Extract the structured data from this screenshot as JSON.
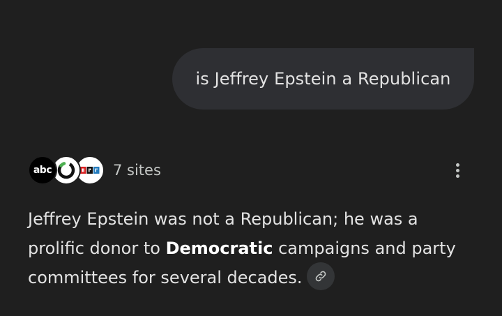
{
  "user_query": "is Jeffrey Epstein a Republican",
  "sources": {
    "logos": [
      {
        "name": "abc",
        "text": "abc"
      },
      {
        "name": "ring-logo"
      },
      {
        "name": "npr"
      }
    ],
    "count_label": "7 sites"
  },
  "answer": {
    "part1": "Jeffrey Epstein was not a Republican; he was a prolific donor to ",
    "bold": "Democratic",
    "part2": " campaigns and party committees for several decades."
  },
  "icons": {
    "more": "more-vert-icon",
    "link": "link-icon"
  },
  "colors": {
    "background": "#1f1f1f",
    "bubble": "#2e2f33",
    "text": "#e3e3e3",
    "muted": "#c4c7c5"
  }
}
